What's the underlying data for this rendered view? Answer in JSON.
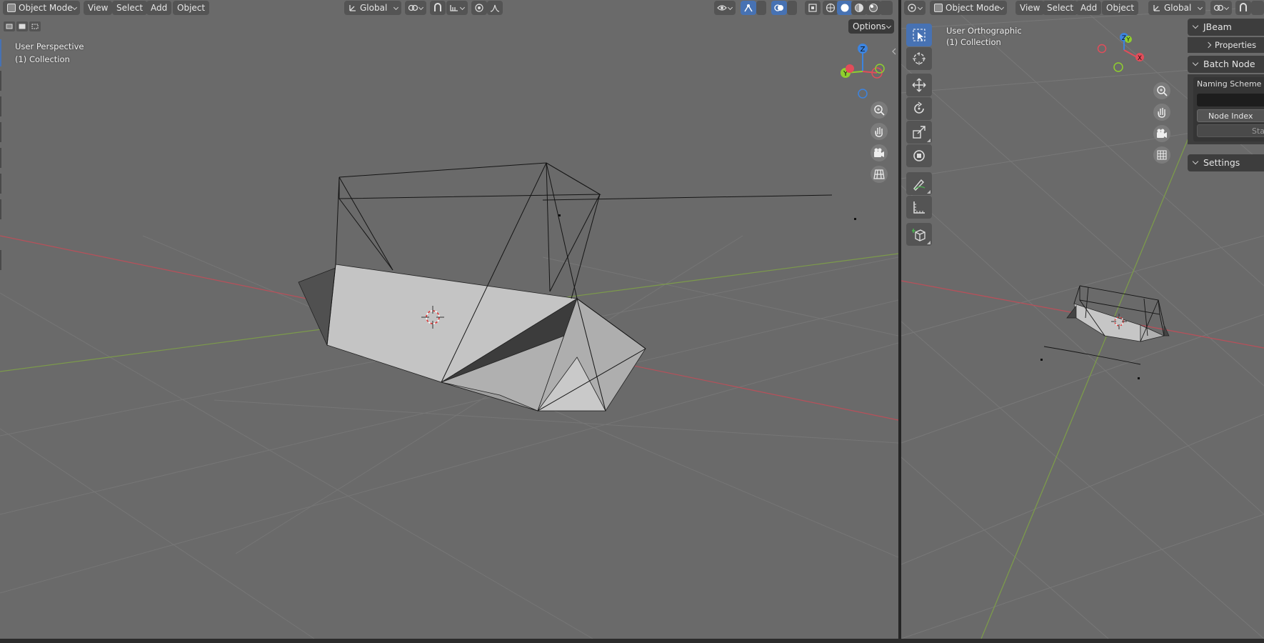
{
  "left_viewport": {
    "header": {
      "mode": "Object Mode",
      "menus": [
        "View",
        "Select",
        "Add",
        "Object"
      ],
      "transform_orientation": "Global"
    },
    "options_label": "Options",
    "view_name": "User Perspective",
    "collection": "(1) Collection",
    "gizmo_axes": {
      "z": "Z",
      "y": "Y"
    }
  },
  "right_viewport": {
    "header": {
      "mode": "Object Mode",
      "menus": [
        "View",
        "Select",
        "Add",
        "Object"
      ],
      "transform_orientation": "Global"
    },
    "view_name": "User Orthographic",
    "collection": "(1) Collection",
    "gizmo_axes": {
      "z": "Z",
      "y": "Y",
      "x": "X"
    }
  },
  "sidebar": {
    "jbeam_title": "JBeam",
    "properties_label": "Properties",
    "batch_title": "Batch Node Re",
    "naming_scheme_label": "Naming Scheme",
    "naming_scheme_value": "",
    "node_index_label": "Node Index",
    "start_label": "Start",
    "settings_title": "Settings"
  },
  "colors": {
    "viewport_bg": "#6a6a6a",
    "ui_bg": "#3d3d3d",
    "button_bg": "#545454",
    "active_accent": "#4772b3",
    "axis_x": "#e24d5a",
    "axis_y": "#8fcf2e",
    "axis_z": "#3c84e0"
  },
  "icons": {
    "left_header": [
      "editor-type-icon",
      "select-mode-icons",
      "pivot-icon",
      "snap-icon",
      "proportional-icon",
      "visibility-icon",
      "gizmo-icon",
      "overlay-icon",
      "xray-icon",
      "shading-wire-icon",
      "shading-solid-icon",
      "shading-material-icon",
      "shading-render-icon"
    ],
    "navigation": [
      "zoom-icon",
      "pan-hand-icon",
      "camera-icon",
      "grid-icon"
    ],
    "toolbar": [
      "select-box-icon",
      "cursor-icon",
      "move-icon",
      "rotate-icon",
      "scale-icon",
      "transform-icon",
      "annotate-icon",
      "measure-icon",
      "add-cube-icon"
    ]
  }
}
